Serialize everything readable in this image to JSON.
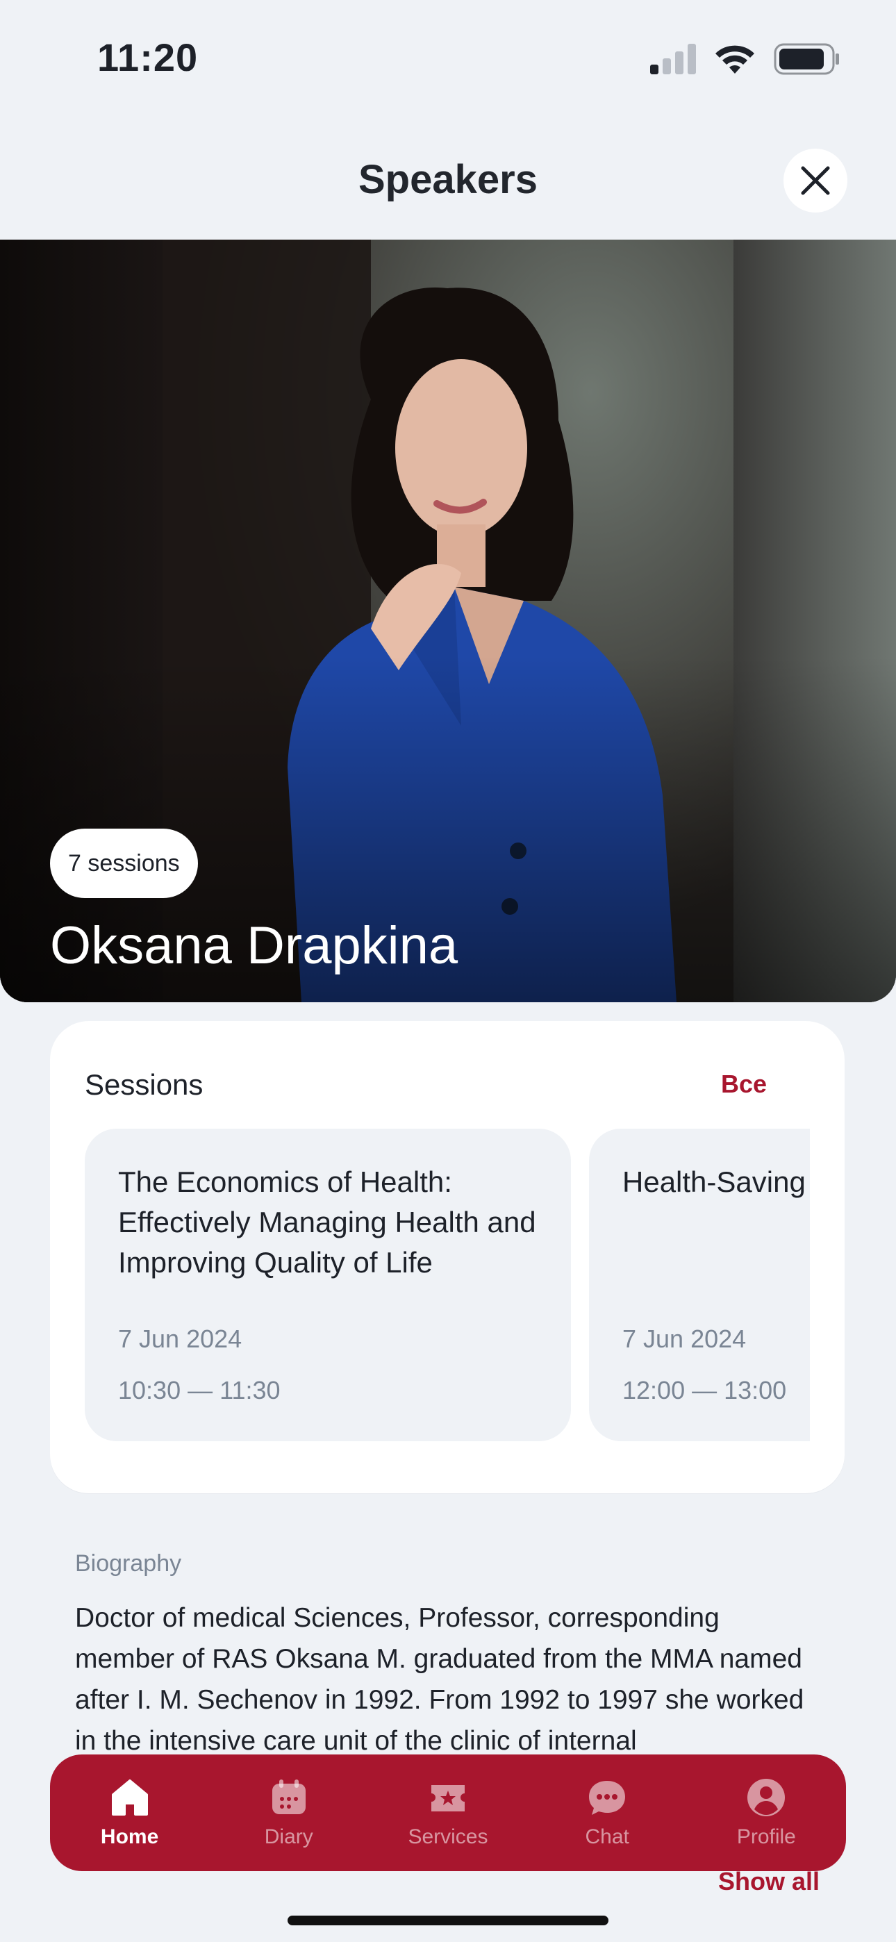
{
  "status_bar": {
    "time": "11:20"
  },
  "header": {
    "title": "Speakers"
  },
  "hero": {
    "sessions_badge": "7 sessions",
    "speaker_name": "Oksana Drapkina"
  },
  "sessions": {
    "title": "Sessions",
    "all_label": "Все",
    "items": [
      {
        "title": "The Economics of Health: Effectively Managing Health and Improving Quality of Life",
        "date": "7 Jun 2024",
        "time": "10:30 — 11:30"
      },
      {
        "title": "Health-Saving The Road to L",
        "date": "7 Jun 2024",
        "time": "12:00 — 13:00"
      }
    ]
  },
  "biography": {
    "label": "Biography",
    "text": "Doctor of medical Sciences, Professor, corresponding member of RAS Oksana M. graduated from the MMA named after I. M. Sechenov in 1992. From 1992 to 1997 she worked in the intensive care unit of the clinic of internal"
  },
  "show_all": "Show all",
  "tabbar": {
    "items": [
      {
        "label": "Home",
        "icon": "home-icon",
        "active": true
      },
      {
        "label": "Diary",
        "icon": "calendar-icon",
        "active": false
      },
      {
        "label": "Services",
        "icon": "ticket-star-icon",
        "active": false
      },
      {
        "label": "Chat",
        "icon": "chat-bubble-icon",
        "active": false
      },
      {
        "label": "Profile",
        "icon": "user-circle-icon",
        "active": false
      }
    ]
  },
  "colors": {
    "accent": "#a8162e",
    "background": "#eff2f6"
  }
}
